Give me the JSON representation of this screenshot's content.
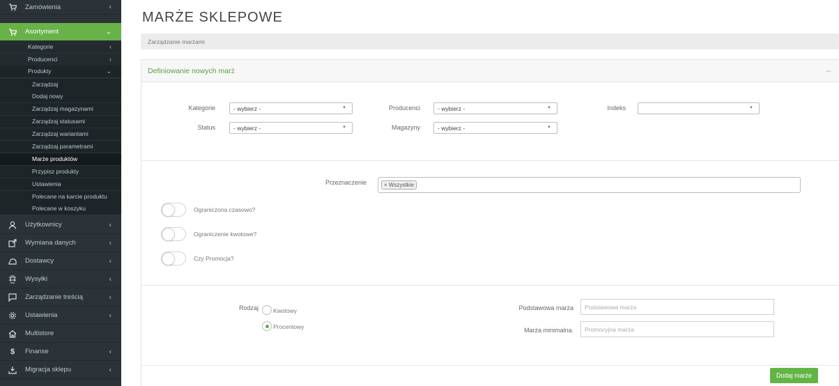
{
  "sidebar": {
    "main_items_top": [
      {
        "label": "Zamówienia",
        "icon": "cart-icon"
      },
      {
        "label": "Asortyment",
        "icon": "cart-icon"
      }
    ],
    "asortyment_sub": [
      {
        "label": "Kategorie"
      },
      {
        "label": "Producenci"
      },
      {
        "label": "Produkty"
      }
    ],
    "produkty_sub": [
      {
        "label": "Zarządzaj"
      },
      {
        "label": "Dodaj nowy"
      },
      {
        "label": "Zarządzaj magazynami"
      },
      {
        "label": "Zarządzaj statusami"
      },
      {
        "label": "Zarządzaj wariantami"
      },
      {
        "label": "Zarządzaj parametrami"
      },
      {
        "label": "Marże produktów"
      },
      {
        "label": "Przypisz produkty"
      },
      {
        "label": "Ustawienia"
      },
      {
        "label": "Polecane na karcie produktu"
      },
      {
        "label": "Polecane w koszyku"
      }
    ],
    "main_items_bottom": [
      {
        "label": "Użytkownicy",
        "icon": "user-icon"
      },
      {
        "label": "Wymiana danych",
        "icon": "exchange-icon"
      },
      {
        "label": "Dostawcy",
        "icon": "supplier-icon"
      },
      {
        "label": "Wysyłki",
        "icon": "shipping-icon"
      },
      {
        "label": "Zarządzanie treścią",
        "icon": "comment-icon"
      },
      {
        "label": "Ustawienia",
        "icon": "gear-icon"
      },
      {
        "label": "Multistore",
        "icon": "home-icon"
      },
      {
        "label": "Finanse",
        "icon": "dollar-icon"
      },
      {
        "label": "Migracja sklepu",
        "icon": "download-icon"
      }
    ],
    "active_color": "#69b24a"
  },
  "page": {
    "title": "MARŻE SKLEPOWE",
    "breadcrumb": "Zarządzanie marżami"
  },
  "panel": {
    "title": "Definiowanie nowych marż",
    "collapse_symbol": "–"
  },
  "filters": {
    "kategorie_label": "Kategorie",
    "kategorie_value": "- wybierz -",
    "producenci_label": "Producenci",
    "producenci_value": "- wybierz -",
    "indeks_label": "Indeks",
    "indeks_value": "",
    "status_label": "Status",
    "status_value": "- wybierz -",
    "magazyny_label": "Magazyny",
    "magazyny_value": "- wybierz -"
  },
  "options": {
    "przeznaczenie_label": "Przeznaczenie",
    "przeznaczenie_tag": "× Wszystkie",
    "toggle_time_label": "Ograniczona czasowo?",
    "toggle_amount_label": "Ograniczenie kwotowe?",
    "toggle_promo_label": "Czy Promocja?"
  },
  "rodzaj": {
    "label": "Rodzaj",
    "option_kwotowy": "Kwotowy",
    "option_procentowy": "Procentowy",
    "selected": "Procentowy"
  },
  "margins": {
    "podstawowa_label": "Podstawowa marża",
    "podstawowa_placeholder": "Podstawowa marża",
    "minimalna_label": "Marża minimalna.",
    "minimalna_placeholder": "Promocyjna marża"
  },
  "submit_label": "Dodaj marże",
  "colors": {
    "accent_green": "#62b545",
    "panel_title_green": "#5a9d45",
    "sidebar_bg": "#2b3338"
  }
}
